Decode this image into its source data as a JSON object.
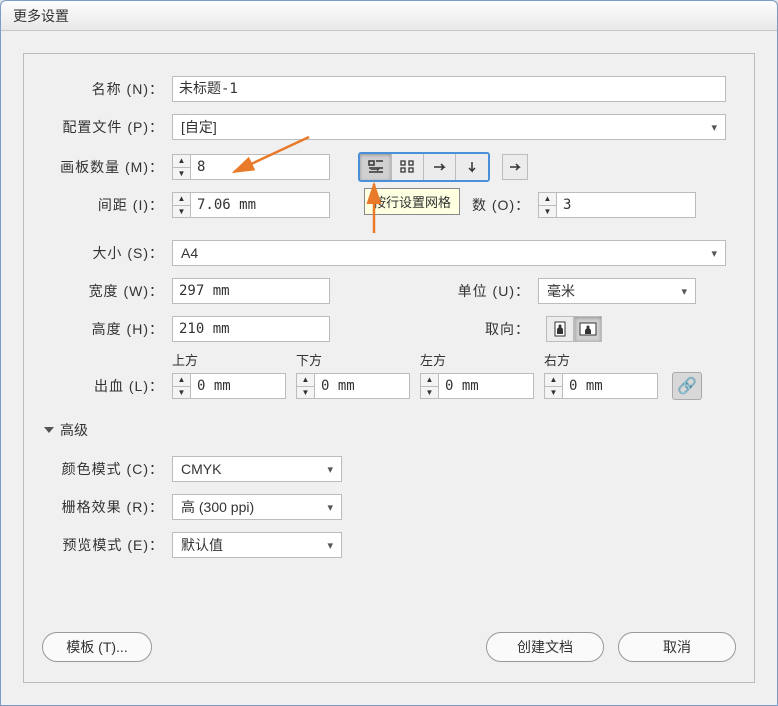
{
  "window": {
    "title": "更多设置"
  },
  "labels": {
    "name": "名称 (N)：",
    "profile": "配置文件 (P)：",
    "artboards": "画板数量 (M)：",
    "spacing": "间距 (I)：",
    "columns": "数 (O)：",
    "size": "大小 (S)：",
    "width": "宽度 (W)：",
    "height": "高度 (H)：",
    "units": "单位 (U)：",
    "orientation": "取向：",
    "bleed": "出血 (L)：",
    "top": "上方",
    "bottom": "下方",
    "left": "左方",
    "right": "右方",
    "advanced": "高级",
    "colorMode": "颜色模式 (C)：",
    "raster": "栅格效果 (R)：",
    "preview": "预览模式 (E)："
  },
  "values": {
    "name": "未标题-1",
    "profile": "[自定]",
    "artboards": "8",
    "spacing": "7.06 mm",
    "columns": "3",
    "size": "A4",
    "width": "297 mm",
    "height": "210 mm",
    "units": "毫米",
    "bleedTop": "0 mm",
    "bleedBottom": "0 mm",
    "bleedLeft": "0 mm",
    "bleedRight": "0 mm",
    "colorMode": "CMYK",
    "raster": "高 (300 ppi)",
    "preview": "默认值"
  },
  "tooltip": "按行设置网格",
  "buttons": {
    "templates": "模板 (T)...",
    "create": "创建文档",
    "cancel": "取消"
  },
  "icons": {
    "grid_row": "grid-row-icon",
    "grid_col": "grid-col-icon",
    "arrange_right": "arrange-right-icon",
    "arrange_down": "arrange-down-icon",
    "direction": "direction-icon",
    "portrait": "portrait-icon",
    "landscape": "landscape-icon",
    "link": "link-icon"
  }
}
